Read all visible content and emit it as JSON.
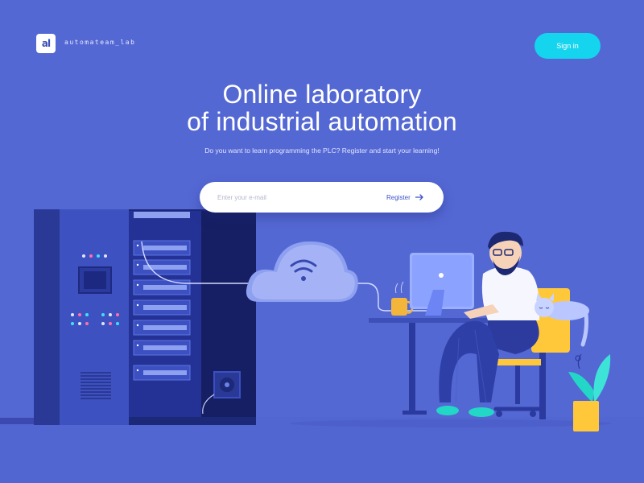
{
  "brand": {
    "logo_text": "al",
    "name": "automateam_lab"
  },
  "header": {
    "signin_label": "Sign in"
  },
  "hero": {
    "title_line1": "Online laboratory",
    "title_line2": "of industrial automation",
    "subtitle": "Do you want to learn programming the PLC? Register and start your learning!"
  },
  "signup": {
    "email_placeholder": "Enter your e-mail",
    "register_label": "Register"
  },
  "colors": {
    "background": "#5468d4",
    "accent": "#14d4ee",
    "button_text": "#3d52c8"
  },
  "icons": [
    "logo-icon",
    "arrow-right-icon",
    "wifi-icon",
    "server-rack-illustration",
    "cloud-illustration",
    "person-illustration",
    "cat-illustration",
    "plant-illustration",
    "coffee-mug-illustration"
  ]
}
